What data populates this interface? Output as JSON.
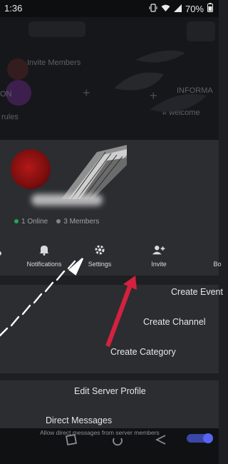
{
  "status_bar": {
    "time": "1:36",
    "battery": "70%"
  },
  "background": {
    "channel_invite_members": "Invite Members",
    "channel_informa": "INFORMA",
    "channel_rules": "rules",
    "channel_welcome": "# welcome"
  },
  "server": {
    "online": "1 Online",
    "members": "3 Members",
    "online_color": "#23a55a",
    "members_color": "#80848e"
  },
  "actions": [
    {
      "label": "Notifications",
      "icon": "bell-icon"
    },
    {
      "label": "Settings",
      "icon": "gear-icon"
    },
    {
      "label": "Invite",
      "icon": "add-person-icon"
    },
    {
      "label": "Bo",
      "icon": "boost-icon"
    }
  ],
  "menu": {
    "create_event": "Create Event",
    "create_channel": "Create Channel",
    "create_category": "Create Category",
    "edit_server_profile": "Edit Server Profile",
    "direct_messages": "Direct Messages",
    "direct_messages_sub": "Allow direct messages from server members"
  },
  "accent_colors": {
    "annotation_white": "#ffffff",
    "annotation_red": "#d4213d",
    "toggle_blue": "#5865f2"
  }
}
